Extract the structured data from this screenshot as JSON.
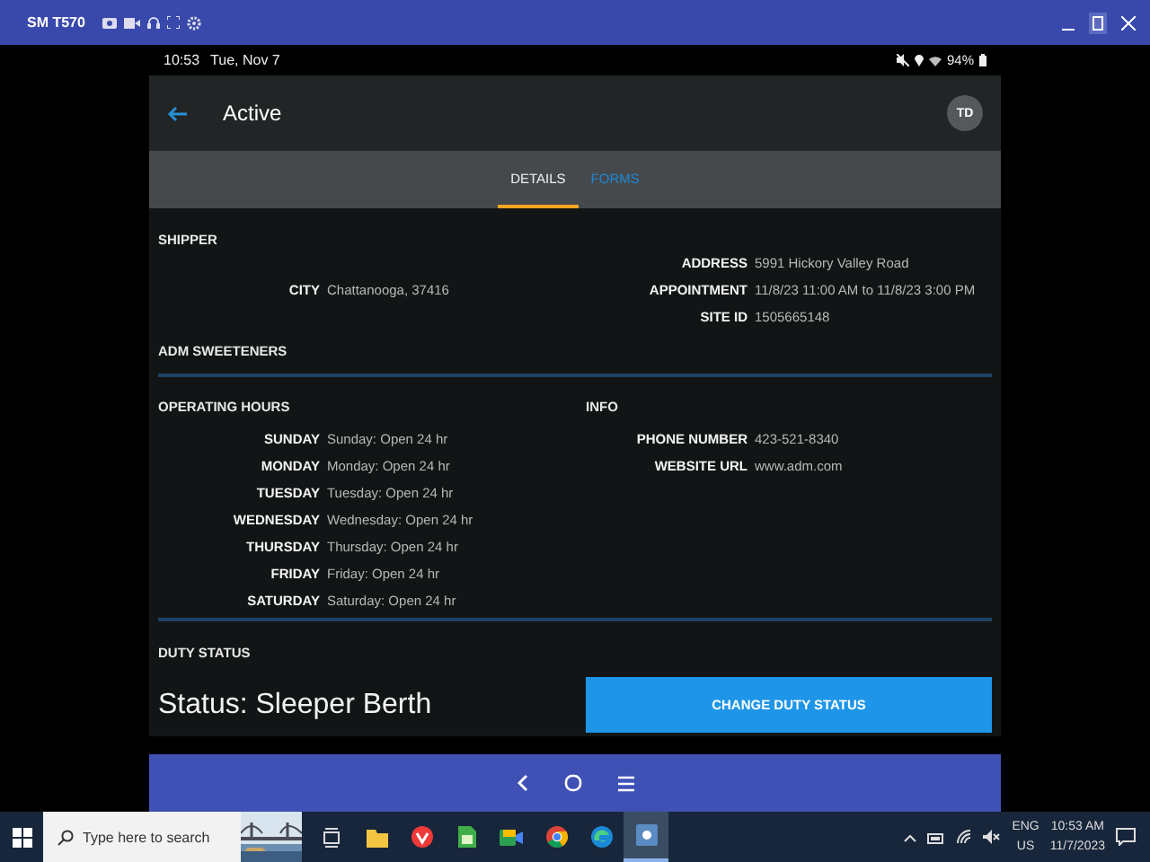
{
  "mirror_window": {
    "title": "SM T570"
  },
  "status_bar": {
    "time": "10:53",
    "date": "Tue, Nov 7",
    "battery": "94%"
  },
  "app_bar": {
    "title": "Active",
    "avatar": "TD"
  },
  "tabs": [
    {
      "label": "DETAILS",
      "selected": true
    },
    {
      "label": "FORMS",
      "selected": false
    }
  ],
  "shipper": {
    "title": "SHIPPER",
    "left": [
      {
        "label": "CITY",
        "value": "Chattanooga, 37416"
      }
    ],
    "right": [
      {
        "label": "ADDRESS",
        "value": "5991 Hickory Valley Road"
      },
      {
        "label": "APPOINTMENT",
        "value": "11/8/23 11:00 AM to 11/8/23 3:00 PM"
      },
      {
        "label": "SITE ID",
        "value": "1505665148"
      }
    ]
  },
  "company_name": "ADM SWEETENERS",
  "operating_hours": {
    "title": "OPERATING HOURS",
    "rows": [
      {
        "label": "SUNDAY",
        "value": "Sunday: Open 24 hr"
      },
      {
        "label": "MONDAY",
        "value": "Monday: Open 24 hr"
      },
      {
        "label": "TUESDAY",
        "value": "Tuesday: Open 24 hr"
      },
      {
        "label": "WEDNESDAY",
        "value": "Wednesday: Open 24 hr"
      },
      {
        "label": "THURSDAY",
        "value": "Thursday: Open 24 hr"
      },
      {
        "label": "FRIDAY",
        "value": "Friday: Open 24 hr"
      },
      {
        "label": "SATURDAY",
        "value": "Saturday: Open 24 hr"
      }
    ]
  },
  "info": {
    "title": "INFO",
    "rows": [
      {
        "label": "PHONE NUMBER",
        "value": "423-521-8340"
      },
      {
        "label": "WEBSITE URL",
        "value": "www.adm.com"
      }
    ]
  },
  "duty_status": {
    "title": "DUTY STATUS",
    "status": "Status: Sleeper Berth",
    "button": "CHANGE DUTY STATUS"
  },
  "taskbar": {
    "search_placeholder": "Type here to search",
    "apps": [
      {
        "kind": "folder",
        "selected": false
      },
      {
        "kind": "red-badge",
        "selected": false
      },
      {
        "kind": "green-sheet",
        "selected": false
      },
      {
        "kind": "camera",
        "selected": false
      },
      {
        "kind": "ring",
        "selected": false
      },
      {
        "kind": "swirl",
        "selected": false
      },
      {
        "kind": "mirror",
        "selected": true
      }
    ],
    "language": "ENG",
    "region": "US",
    "time": "10:53 AM",
    "date": "11/7/2023"
  }
}
